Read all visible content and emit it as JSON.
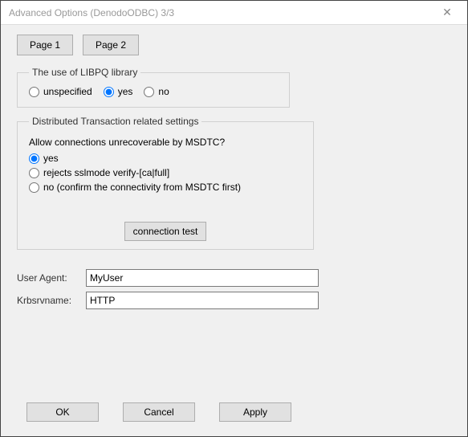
{
  "titlebar": {
    "title": "Advanced Options (DenodoODBC) 3/3"
  },
  "tabs": {
    "page1": "Page 1",
    "page2": "Page 2"
  },
  "libpq": {
    "legend": "The use of LIBPQ library",
    "options": {
      "unspecified": "unspecified",
      "yes": "yes",
      "no": "no"
    },
    "selected": "yes"
  },
  "dtx": {
    "legend": "Distributed Transaction related settings",
    "question": "Allow connections unrecoverable by MSDTC?",
    "options": {
      "yes": "yes",
      "rejects": "rejects sslmode verify-[ca|full]",
      "no": "no (confirm the connectivity from MSDTC first)"
    },
    "selected": "yes",
    "conn_test_label": "connection test"
  },
  "form": {
    "user_agent_label": "User Agent:",
    "user_agent_value": "MyUser",
    "krbsrvname_label": "Krbsrvname:",
    "krbsrvname_value": "HTTP"
  },
  "footer": {
    "ok": "OK",
    "cancel": "Cancel",
    "apply": "Apply"
  }
}
